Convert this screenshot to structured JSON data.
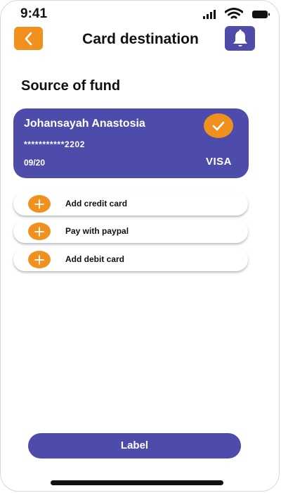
{
  "status_bar": {
    "time": "9:41",
    "icons": [
      "cellular-signal-icon",
      "wifi-icon",
      "battery-icon"
    ]
  },
  "header": {
    "title": "Card destination",
    "back_icon": "chevron-left-icon",
    "notification_icon": "bell-icon"
  },
  "section_title": "Source of fund",
  "card": {
    "holder_name": "Johansayah Anastosia",
    "number": "***********2202",
    "expiry": "09/20",
    "brand": "VISA",
    "selected_icon": "check-icon"
  },
  "options": [
    {
      "label": "Add credit card",
      "icon": "plus-icon"
    },
    {
      "label": "Pay with paypal",
      "icon": "plus-icon"
    },
    {
      "label": "Add debit card",
      "icon": "plus-icon"
    }
  ],
  "primary_button": {
    "label": "Label"
  },
  "colors": {
    "accent_orange": "#f0901e",
    "primary_purple": "#4e4caa",
    "text": "#111111",
    "background": "#ffffff"
  }
}
